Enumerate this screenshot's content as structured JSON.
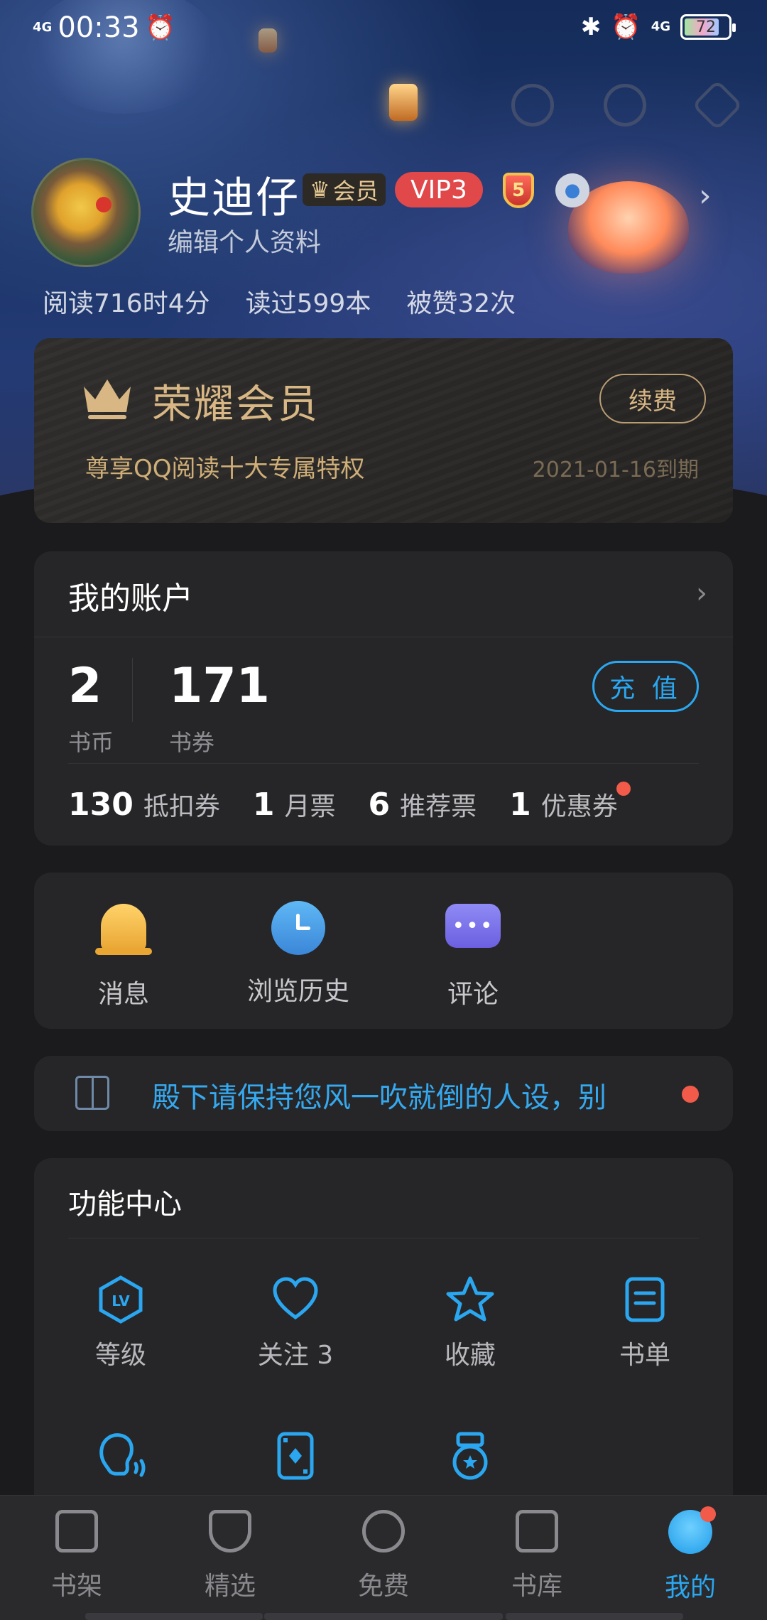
{
  "status": {
    "time": "00:33",
    "signal_left": "4G",
    "signal_right": "4G",
    "battery": "72"
  },
  "profile": {
    "name": "史迪仔",
    "member_badge": "会员",
    "vip_badge": "VIP3",
    "level_badge": "5",
    "edit_label": "编辑个人资料",
    "stats": [
      "阅读716时4分",
      "读过599本",
      "被赞32次"
    ]
  },
  "vip_card": {
    "title": "荣耀会员",
    "renew_label": "续费",
    "subtitle": "尊享QQ阅读十大专属特权",
    "expiry": "2021-01-16到期"
  },
  "account": {
    "title": "我的账户",
    "coins": {
      "value": "2",
      "label": "书币"
    },
    "vouchers": {
      "value": "171",
      "label": "书券"
    },
    "recharge_label": "充 值",
    "tickets": [
      {
        "num": "130",
        "label": "抵扣券"
      },
      {
        "num": "1",
        "label": "月票"
      },
      {
        "num": "6",
        "label": "推荐票"
      },
      {
        "num": "1",
        "label": "优惠券"
      }
    ]
  },
  "quick": [
    {
      "label": "消息",
      "icon": "bell-icon"
    },
    {
      "label": "浏览历史",
      "icon": "clock-icon"
    },
    {
      "label": "评论",
      "icon": "comment-icon"
    }
  ],
  "notice": {
    "text": "殿下请保持您风一吹就倒的人设，别"
  },
  "functions": {
    "title": "功能中心",
    "items": [
      {
        "label": "等级",
        "icon": "level-icon"
      },
      {
        "label": "关注 3",
        "icon": "heart-icon"
      },
      {
        "label": "收藏",
        "icon": "star-icon"
      },
      {
        "label": "书单",
        "icon": "booklist-icon"
      },
      {
        "label": "",
        "icon": "voice-icon"
      },
      {
        "label": "",
        "icon": "card-icon"
      },
      {
        "label": "",
        "icon": "medal-icon"
      }
    ]
  },
  "tabs": [
    {
      "label": "书架",
      "icon": "bookshelf-icon"
    },
    {
      "label": "精选",
      "icon": "featured-icon"
    },
    {
      "label": "免费",
      "icon": "free-icon"
    },
    {
      "label": "书库",
      "icon": "library-icon"
    },
    {
      "label": "我的",
      "icon": "profile-icon"
    }
  ],
  "colors": {
    "accent": "#2aa7f0",
    "gold": "#d8b784",
    "red_dot": "#f25a4a"
  }
}
